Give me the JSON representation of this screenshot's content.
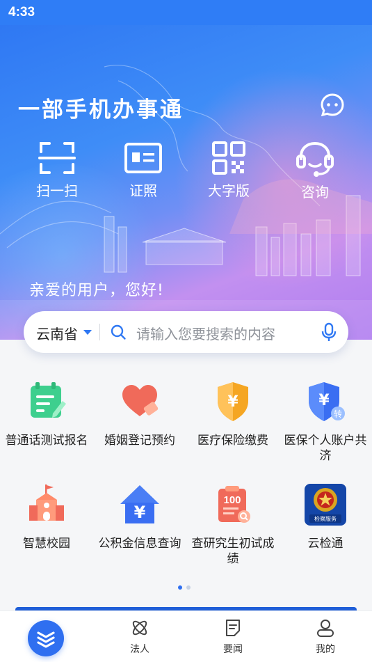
{
  "status_bar": {
    "time": "4:33"
  },
  "hero": {
    "slogan": "一部手机办事通",
    "greeting": "亲爱的用户，您好!",
    "quick_actions": [
      {
        "label": "扫一扫",
        "icon": "scan-icon"
      },
      {
        "label": "证照",
        "icon": "id-card-icon"
      },
      {
        "label": "大字版",
        "icon": "qr-grid-icon"
      },
      {
        "label": "咨询",
        "icon": "headset-icon"
      }
    ]
  },
  "search": {
    "region": "云南省",
    "placeholder": "请输入您要搜索的内容"
  },
  "services": [
    {
      "label": "普通话测试报名",
      "icon": "mandarin-test-icon"
    },
    {
      "label": "婚姻登记预约",
      "icon": "heart-icon"
    },
    {
      "label": "医疗保险缴费",
      "icon": "yuan-shield-icon"
    },
    {
      "label": "医保个人账户共济",
      "icon": "yuan-transfer-icon"
    },
    {
      "label": "智慧校园",
      "icon": "school-icon"
    },
    {
      "label": "公积金信息查询",
      "icon": "yuan-house-icon"
    },
    {
      "label": "查研究生初试成绩",
      "icon": "score-sheet-icon"
    },
    {
      "label": "云检通",
      "icon": "procuratorate-emblem-icon"
    }
  ],
  "emblem_text": "检察服务",
  "score_badge": "100",
  "pager": {
    "current": 1,
    "total": 2
  },
  "tabbar": {
    "items": [
      {
        "label": "",
        "icon": "home-logo-icon",
        "active": true
      },
      {
        "label": "法人",
        "icon": "atom-icon"
      },
      {
        "label": "要闻",
        "icon": "news-icon"
      },
      {
        "label": "我的",
        "icon": "user-icon"
      }
    ]
  },
  "colors": {
    "primary": "#2f6ff0",
    "status_bar": "#2f7df6",
    "accent_orange": "#f5a623",
    "accent_red": "#f06a5a"
  }
}
